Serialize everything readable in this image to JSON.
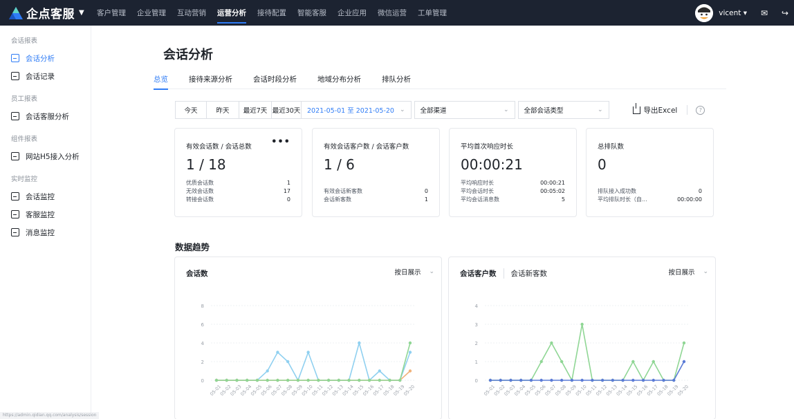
{
  "topbar": {
    "logo_text": "企点客服",
    "nav": [
      "客户管理",
      "企业管理",
      "互动营销",
      "运营分析",
      "接待配置",
      "智能客服",
      "企业应用",
      "微信运营",
      "工单管理"
    ],
    "active_nav": 3,
    "user_name": "vicent ▾",
    "brand_color": "#2f7cf6"
  },
  "sidebar": {
    "groups": [
      {
        "title": "会话报表",
        "items": [
          {
            "label": "会话分析",
            "icon": "chart-icon",
            "active": true
          },
          {
            "label": "会话记录",
            "icon": "record-icon"
          }
        ]
      },
      {
        "title": "员工报表",
        "items": [
          {
            "label": "会话客服分析",
            "icon": "agent-chat-icon"
          }
        ]
      },
      {
        "title": "组件报表",
        "items": [
          {
            "label": "网站H5接入分析",
            "icon": "web-h5-icon"
          }
        ]
      },
      {
        "title": "实时监控",
        "items": [
          {
            "label": "会话监控",
            "icon": "session-monitor-icon"
          },
          {
            "label": "客服监控",
            "icon": "agent-monitor-icon"
          },
          {
            "label": "消息监控",
            "icon": "message-monitor-icon"
          }
        ]
      }
    ]
  },
  "page": {
    "title": "会话分析",
    "tabs": [
      "总览",
      "接待来源分析",
      "会话时段分析",
      "地域分布分析",
      "排队分析"
    ],
    "active_tab": 0
  },
  "filters": {
    "quick": [
      "今天",
      "昨天",
      "最近7天",
      "最近30天"
    ],
    "date_range": "2021-05-01 至 2021-05-20",
    "channel": "全部渠道",
    "session_type": "全部会话类型",
    "export_label": "导出Excel"
  },
  "cards": [
    {
      "title": "有效会话数 / 会话总数",
      "value": "1 / 18",
      "more": "•••",
      "rows": [
        [
          "优质会话数",
          "1"
        ],
        [
          "无效会话数",
          "17"
        ],
        [
          "转接会话数",
          "0"
        ]
      ]
    },
    {
      "title": "有效会话客户数 / 会话客户数",
      "value": "1 / 6",
      "rows": [
        [
          "有效会话新客数",
          "0"
        ],
        [
          "会话新客数",
          "1"
        ]
      ]
    },
    {
      "title": "平均首次响应时长",
      "value": "00:00:21",
      "rows": [
        [
          "平均响应时长",
          "00:00:21"
        ],
        [
          "平均会话时长",
          "00:05:02"
        ],
        [
          "平均会话消息数",
          "5"
        ]
      ]
    },
    {
      "title": "总排队数",
      "value": "0",
      "rows": [
        [
          "排队接入成功数",
          "0"
        ],
        [
          "平均排队时长（自...",
          "00:00:00"
        ]
      ]
    }
  ],
  "trend": {
    "title": "数据趋势",
    "view_select": "按日展示"
  },
  "chart_data": [
    {
      "type": "line",
      "title": "会话数",
      "categories": [
        "05-01",
        "05-02",
        "05-03",
        "05-04",
        "05-05",
        "05-06",
        "05-07",
        "05-08",
        "05-09",
        "05-10",
        "05-11",
        "05-12",
        "05-13",
        "05-14",
        "05-15",
        "05-16",
        "05-17",
        "05-18",
        "05-19",
        "05-20"
      ],
      "ylim": [
        0,
        8
      ],
      "yticks": [
        0,
        2,
        4,
        6,
        8
      ],
      "series": [
        {
          "values": [
            0,
            0,
            0,
            0,
            0,
            1,
            3,
            2,
            0,
            3,
            0,
            0,
            0,
            0,
            4,
            0,
            1,
            0,
            0,
            3
          ],
          "color": "#8fd0f0"
        },
        {
          "values": [
            0,
            0,
            0,
            0,
            0,
            0,
            0,
            0,
            0,
            0,
            0,
            0,
            0,
            0,
            0,
            0,
            0,
            0,
            0,
            1
          ],
          "color": "#f0b27a"
        },
        {
          "values": [
            0,
            0,
            0,
            0,
            0,
            0,
            0,
            0,
            0,
            0,
            0,
            0,
            0,
            0,
            0,
            0,
            0,
            0,
            0,
            4
          ],
          "color": "#8fd694"
        }
      ]
    },
    {
      "type": "line",
      "title": "会话客户数",
      "tabs": [
        "会话客户数",
        "会话新客数"
      ],
      "categories": [
        "05-01",
        "05-02",
        "05-03",
        "05-04",
        "05-05",
        "05-06",
        "05-07",
        "05-08",
        "05-09",
        "05-10",
        "05-11",
        "05-12",
        "05-13",
        "05-14",
        "05-15",
        "05-16",
        "05-17",
        "05-18",
        "05-19",
        "05-20"
      ],
      "ylim": [
        0,
        4
      ],
      "yticks": [
        0,
        1,
        2,
        3,
        4
      ],
      "series": [
        {
          "values": [
            0,
            0,
            0,
            0,
            0,
            1,
            2,
            1,
            0,
            3,
            0,
            0,
            0,
            0,
            1,
            0,
            1,
            0,
            0,
            2
          ],
          "color": "#8fd694"
        },
        {
          "values": [
            0,
            0,
            0,
            0,
            0,
            0,
            0,
            0,
            0,
            0,
            0,
            0,
            0,
            0,
            0,
            0,
            0,
            0,
            0,
            1
          ],
          "color": "#5b7bd6"
        }
      ]
    }
  ],
  "status_url": "https://admin.qidian.qq.com/analysis/session"
}
